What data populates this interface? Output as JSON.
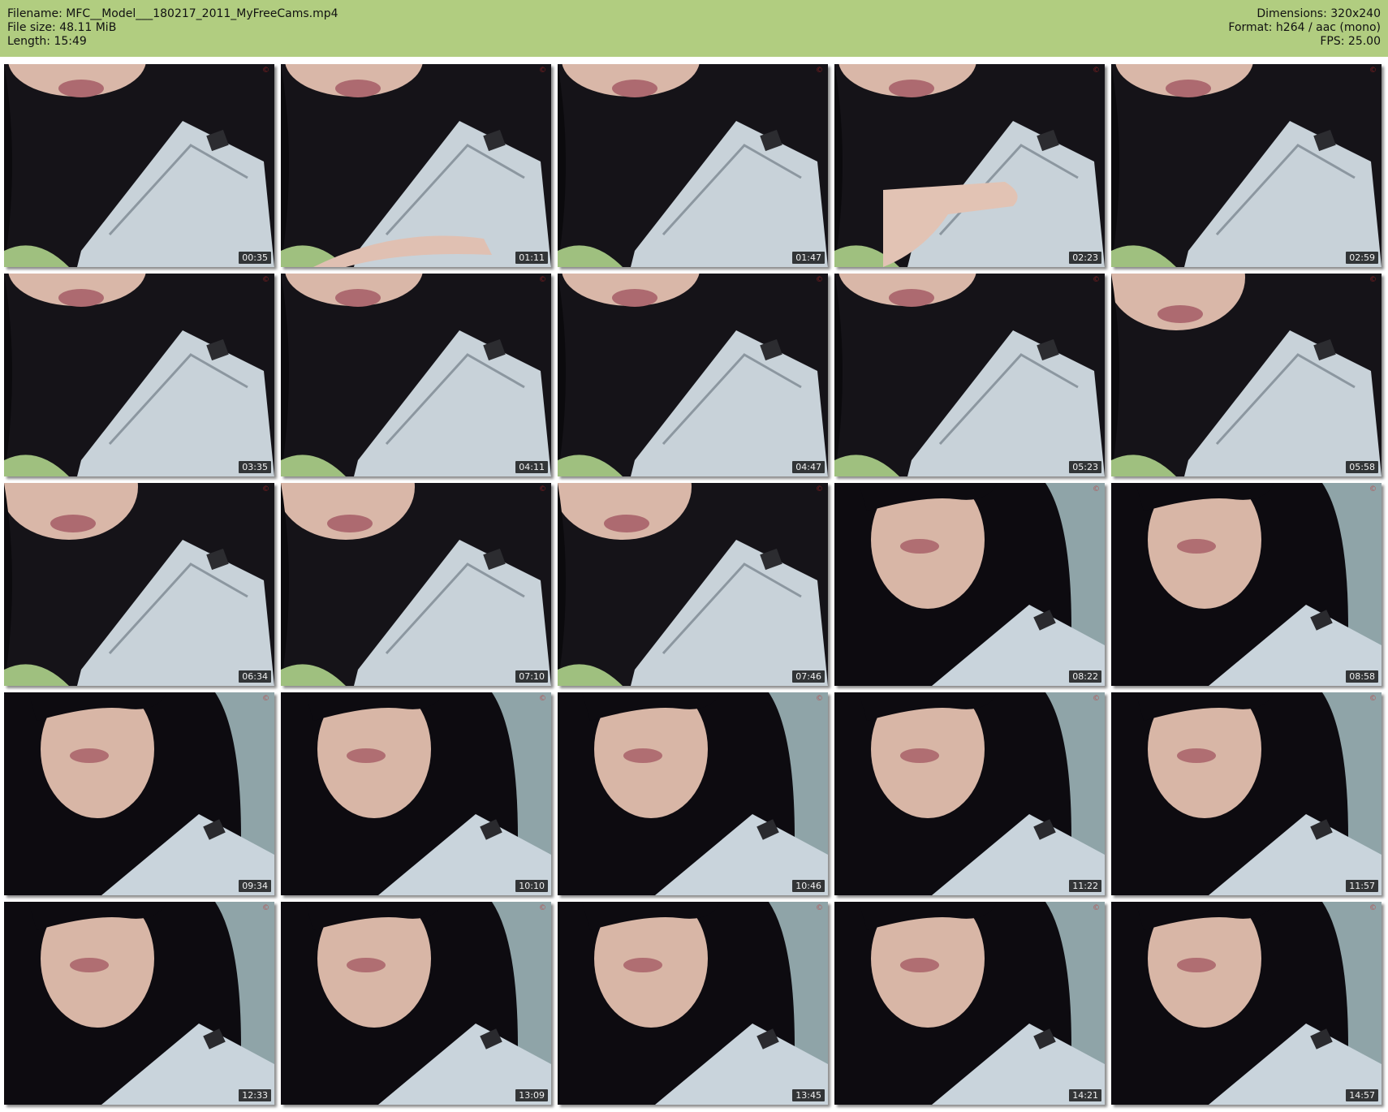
{
  "header": {
    "filename": "Filename: MFC__Model___180217_2011_MyFreeCams.mp4",
    "filesize": "File size: 48.11 MiB",
    "length": "Length: 15:49",
    "dimensions": "Dimensions: 320x240",
    "format": "Format: h264 / aac (mono)",
    "fps": "FPS: 25.00"
  },
  "colors": {
    "header_bg": "#b1cd80",
    "page_bg": "#ffffff",
    "timestamp_bg": "#000000"
  },
  "thumbnails": [
    {
      "time": "00:35",
      "style": "close"
    },
    {
      "time": "01:11",
      "style": "close-arm"
    },
    {
      "time": "01:47",
      "style": "close"
    },
    {
      "time": "02:23",
      "style": "close-hand"
    },
    {
      "time": "02:59",
      "style": "close"
    },
    {
      "time": "03:35",
      "style": "close"
    },
    {
      "time": "04:11",
      "style": "close"
    },
    {
      "time": "04:47",
      "style": "close"
    },
    {
      "time": "05:23",
      "style": "close"
    },
    {
      "time": "05:58",
      "style": "tilt"
    },
    {
      "time": "06:34",
      "style": "tilt"
    },
    {
      "time": "07:10",
      "style": "tilt"
    },
    {
      "time": "07:46",
      "style": "tilt"
    },
    {
      "time": "08:22",
      "style": "face"
    },
    {
      "time": "08:58",
      "style": "face"
    },
    {
      "time": "09:34",
      "style": "face"
    },
    {
      "time": "10:10",
      "style": "face"
    },
    {
      "time": "10:46",
      "style": "face"
    },
    {
      "time": "11:22",
      "style": "face"
    },
    {
      "time": "11:57",
      "style": "face"
    },
    {
      "time": "12:33",
      "style": "face"
    },
    {
      "time": "13:09",
      "style": "face"
    },
    {
      "time": "13:45",
      "style": "face"
    },
    {
      "time": "14:21",
      "style": "face"
    },
    {
      "time": "14:57",
      "style": "face"
    }
  ]
}
